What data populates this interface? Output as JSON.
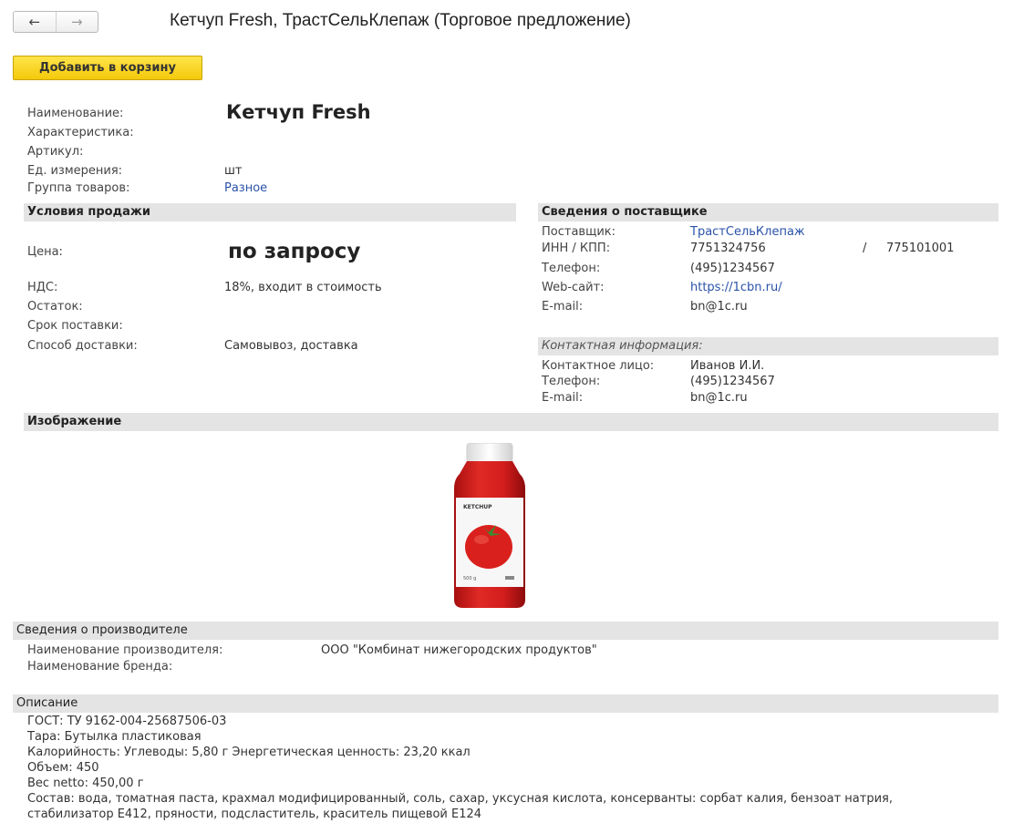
{
  "header": {
    "back_icon": "←",
    "forward_icon": "→",
    "title": "Кетчуп Fresh, ТрастСельКлепаж (Торговое предложение)"
  },
  "actions": {
    "add_to_cart": "Добавить в корзину"
  },
  "product": {
    "name_label": "Наименование:",
    "name_value": "Кетчуп Fresh",
    "characteristic_label": "Характеристика:",
    "article_label": "Артикул:",
    "unit_label": "Ед. измерения:",
    "unit_value": "шт",
    "group_label": "Группа товаров:",
    "group_value": "Разное"
  },
  "sale_terms": {
    "header": "Условия продажи",
    "price_label": "Цена:",
    "price_value": "по запросу",
    "vat_label": "НДС:",
    "vat_value": "18%, входит в стоимость",
    "stock_label": "Остаток:",
    "delivery_time_label": "Срок поставки:",
    "delivery_method_label": "Способ доставки:",
    "delivery_method_value": "Самовывоз, доставка"
  },
  "supplier": {
    "header": "Сведения о поставщике",
    "supplier_label": "Поставщик:",
    "supplier_value": "ТрастСельКлепаж",
    "inn_label": "ИНН / КПП:",
    "inn_value": "7751324756",
    "separator": "/",
    "kpp_value": "775101001",
    "phone_label": "Телефон:",
    "phone_value": "(495)1234567",
    "web_label": "Web-сайт:",
    "web_value": "https://1cbn.ru/",
    "email_label": "E-mail:",
    "email_value": "bn@1c.ru"
  },
  "contact": {
    "header": "Контактная информация:",
    "person_label": "Контактное лицо:",
    "person_value": "Иванов И.И.",
    "phone_label": "Телефон:",
    "phone_value": "(495)1234567",
    "email_label": "E-mail:",
    "email_value": "bn@1c.ru"
  },
  "image_section": {
    "header": "Изображение",
    "bottle_label": "KETCHUP",
    "bottle_weight": "500 g"
  },
  "manufacturer": {
    "header": "Сведения о производителе",
    "name_label": "Наименование производителя:",
    "name_value": "ООО \"Комбинат нижегородских продуктов\"",
    "brand_label": "Наименование бренда:"
  },
  "description": {
    "header": "Описание",
    "lines": [
      "ГОСТ: ТУ 9162-004-25687506-03",
      "Тара: Бутылка пластиковая",
      "Калорийность: Углеводы: 5,80 г Энергетическая ценность: 23,20 ккал",
      "Объем: 450",
      "Вес netto: 450,00 г",
      "Состав: вода, томатная паста, крахмал модифицированный, соль, сахар, уксусная кислота, консерванты: сорбат калия, бензоат натрия,",
      "стабилизатор Е412, пряности, подсластитель, краситель пищевой Е124"
    ]
  },
  "colors": {
    "button_yellow": "#f4c90a",
    "link_blue": "#2a52a8",
    "section_bar": "#e4e4e4",
    "ketchup_red": "#d81f1f"
  }
}
